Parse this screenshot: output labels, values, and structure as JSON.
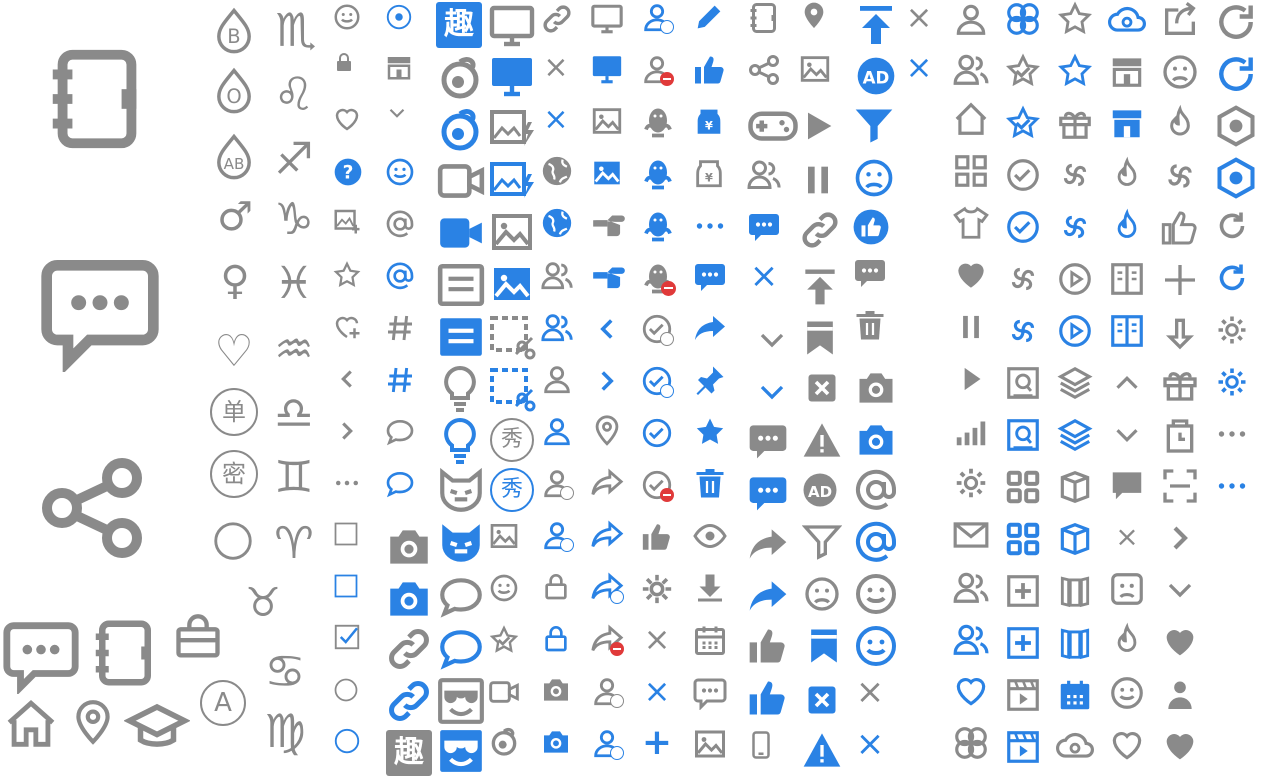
{
  "colors": {
    "gray": "#8a8a8a",
    "blue": "#2a82e4",
    "red": "#e03a3a",
    "white": "#ffffff"
  },
  "glyphs": {
    "qu": "趣",
    "xiu": "秀",
    "dan": "单",
    "mi": "密",
    "letter_b": "B",
    "letter_o": "O",
    "letter_ab": "AB",
    "letter_a": "A",
    "ad": "AD",
    "at": "@",
    "hash": "#",
    "ellipsis": "···",
    "aries": "♈",
    "taurus": "♉",
    "gemini": "♊",
    "cancer": "♋",
    "leo": "♌",
    "virgo": "♍",
    "libra": "♎",
    "scorpio": "♏",
    "sagittarius": "♐",
    "capricorn": "♑",
    "aquarius": "♒",
    "pisces": "♓",
    "male": "♂",
    "female": "♀",
    "heart": "♡",
    "star": "☆",
    "chev_left": "‹",
    "chev_right": "›",
    "plus": "+",
    "close": "×",
    "check": "✓",
    "yen": "¥"
  }
}
